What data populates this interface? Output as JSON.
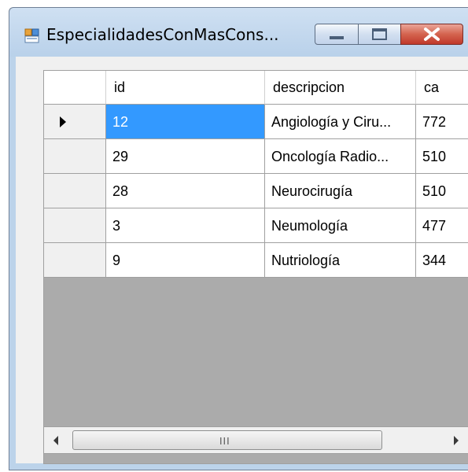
{
  "window": {
    "title": "EspecialidadesConMasCons...",
    "controls": {
      "minimize": "minimize",
      "maximize": "maximize",
      "close": "close"
    }
  },
  "grid": {
    "columns": [
      "id",
      "descripcion",
      "ca"
    ],
    "rows": [
      {
        "id": "12",
        "descripcion": "Angiología y Ciru...",
        "ca": "772"
      },
      {
        "id": "29",
        "descripcion": "Oncología Radio...",
        "ca": "510"
      },
      {
        "id": "28",
        "descripcion": "Neurocirugía",
        "ca": "510"
      },
      {
        "id": "3",
        "descripcion": "Neumología",
        "ca": "477"
      },
      {
        "id": "9",
        "descripcion": "Nutriología",
        "ca": "344"
      }
    ],
    "selected_row": 0,
    "colors": {
      "selection": "#3399ff",
      "empty_area": "#ababab"
    }
  },
  "scrollbar": {
    "grip": "III"
  }
}
